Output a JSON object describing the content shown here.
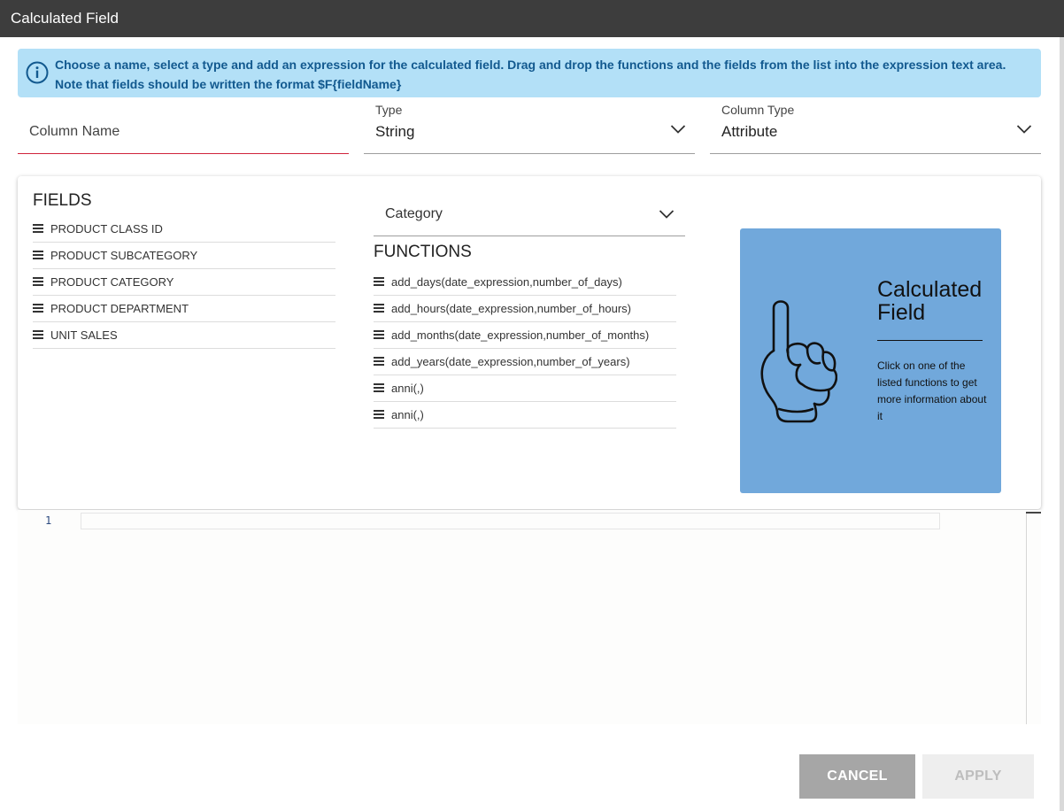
{
  "dialog": {
    "title": "Calculated Field"
  },
  "info": {
    "icon": "info-icon",
    "line1": "Choose a name, select a type and add an expression for the calculated field. Drag and drop the functions and the fields from the list into the expression text area.",
    "line2": "Note that fields should be written the format $F{fieldName}"
  },
  "form": {
    "column_name": {
      "placeholder": "Column Name",
      "value": ""
    },
    "type": {
      "label": "Type",
      "value": "String"
    },
    "column_type": {
      "label": "Column Type",
      "value": "Attribute"
    }
  },
  "fields": {
    "title": "FIELDS",
    "items": [
      {
        "label": "PRODUCT CLASS ID"
      },
      {
        "label": "PRODUCT SUBCATEGORY"
      },
      {
        "label": "PRODUCT CATEGORY"
      },
      {
        "label": "PRODUCT DEPARTMENT"
      },
      {
        "label": "UNIT SALES"
      }
    ]
  },
  "functions": {
    "category": {
      "value": "Category"
    },
    "title": "FUNCTIONS",
    "items": [
      {
        "label": "add_days(date_expression,number_of_days)"
      },
      {
        "label": "add_hours(date_expression,number_of_hours)"
      },
      {
        "label": "add_months(date_expression,number_of_months)"
      },
      {
        "label": "add_years(date_expression,number_of_years)"
      },
      {
        "label": "anni(,)"
      },
      {
        "label": "anni(,)"
      }
    ]
  },
  "help": {
    "icon": "pointing-hand-icon",
    "title": "Calculated Field",
    "description": "Click on one of the listed functions to get more information about it",
    "background": "#71a8db"
  },
  "editor": {
    "line_numbers": [
      "1"
    ],
    "content": ""
  },
  "buttons": {
    "cancel": "CANCEL",
    "apply": "APPLY"
  },
  "colors": {
    "titlebar": "#3d3d3d",
    "info_bg": "#b3e0f7",
    "info_text": "#12598f",
    "required_underline": "#d0233b"
  }
}
